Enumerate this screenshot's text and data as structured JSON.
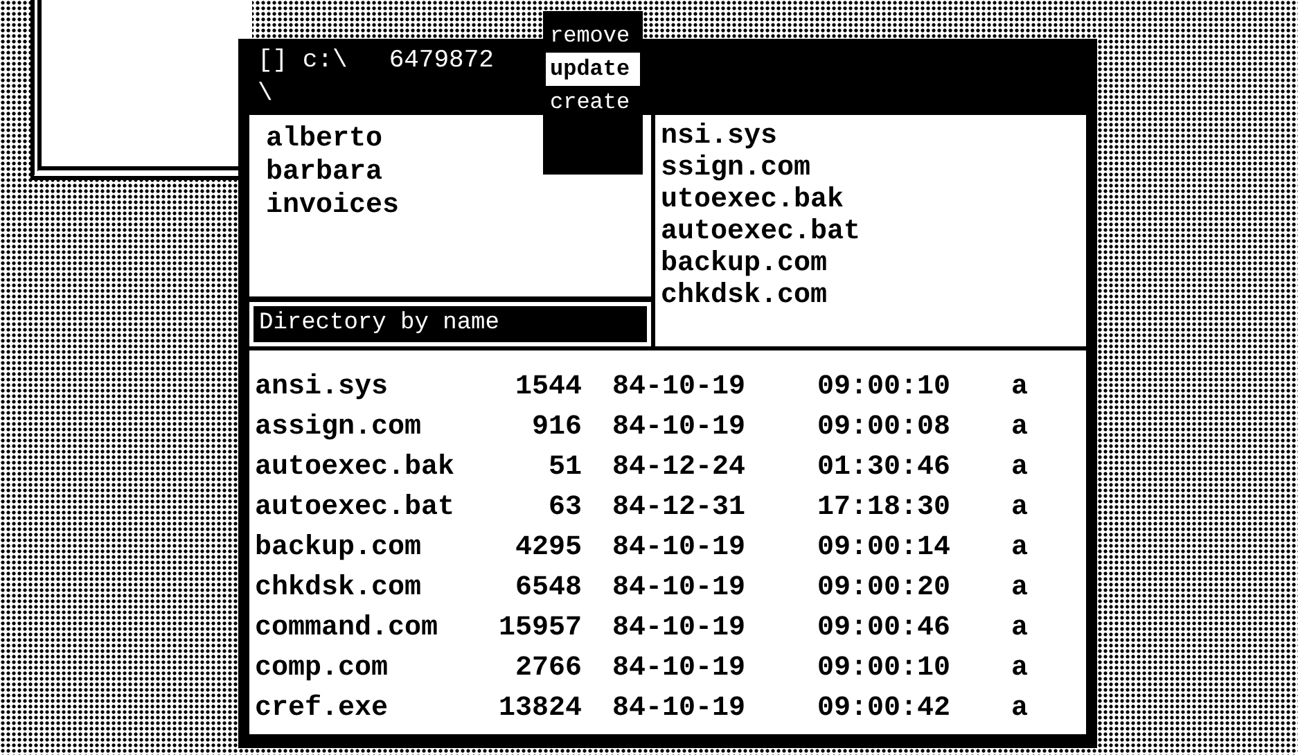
{
  "window": {
    "title": "[] c:\\",
    "free_space": "6479872",
    "path": "\\"
  },
  "directories": [
    "alberto",
    "barbara",
    "invoices"
  ],
  "menu": {
    "items": [
      {
        "label": "remove",
        "selected": false
      },
      {
        "label": "update",
        "selected": true
      },
      {
        "label": "create",
        "selected": false
      }
    ]
  },
  "files": [
    "nsi.sys",
    "ssign.com",
    "utoexec.bak",
    "autoexec.bat",
    "backup.com",
    "chkdsk.com"
  ],
  "status_bar": "Directory by name",
  "table": {
    "rows": [
      [
        "ansi.sys",
        "1544",
        "84-10-19",
        "09:00:10",
        "a"
      ],
      [
        "assign.com",
        "916",
        "84-10-19",
        "09:00:08",
        "a"
      ],
      [
        "autoexec.bak",
        "51",
        "84-12-24",
        "01:30:46",
        "a"
      ],
      [
        "autoexec.bat",
        "63",
        "84-12-31",
        "17:18:30",
        "a"
      ],
      [
        "backup.com",
        "4295",
        "84-10-19",
        "09:00:14",
        "a"
      ],
      [
        "chkdsk.com",
        "6548",
        "84-10-19",
        "09:00:20",
        "a"
      ],
      [
        "command.com",
        "15957",
        "84-10-19",
        "09:00:46",
        "a"
      ],
      [
        "comp.com",
        "2766",
        "84-10-19",
        "09:00:10",
        "a"
      ],
      [
        "cref.exe",
        "13824",
        "84-10-19",
        "09:00:42",
        "a"
      ]
    ]
  }
}
